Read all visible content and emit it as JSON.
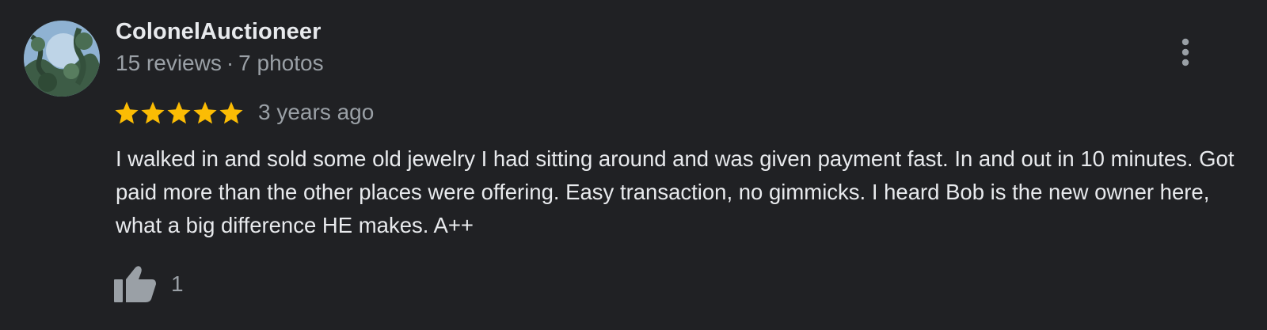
{
  "review": {
    "author": "ColonelAuctioneer",
    "reviews_count": "15 reviews",
    "separator": "·",
    "photos_count": "7 photos",
    "rating": 5,
    "max_rating": 5,
    "date": "3 years ago",
    "text": "I walked in and sold some old jewelry I had sitting around and was given payment fast. In and out in 10 minutes. Got paid more than the other places were offering. Easy transaction, no gimmicks. I heard Bob is the new owner here, what a big difference HE makes. A++",
    "like_count": "1"
  },
  "icons": {
    "avatar": "profile-photo",
    "star": "star-icon",
    "menu": "more-vert-icon",
    "like": "thumbs-up-icon"
  },
  "colors": {
    "background": "#202124",
    "primary_text": "#e8eaed",
    "secondary_text": "#9aa0a6",
    "star": "#fbbc04",
    "icon": "#9aa0a6"
  }
}
